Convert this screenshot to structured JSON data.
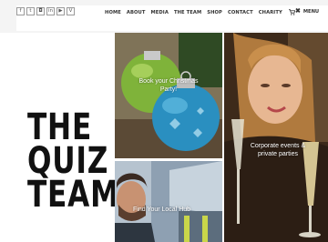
{
  "socials": [
    {
      "icon": "facebook-icon",
      "glyph": "f"
    },
    {
      "icon": "twitter-icon",
      "glyph": "t"
    },
    {
      "icon": "instagram-icon",
      "glyph": "◘"
    },
    {
      "icon": "linkedin-icon",
      "glyph": "in"
    },
    {
      "icon": "youtube-icon",
      "glyph": "▶"
    },
    {
      "icon": "vimeo-icon",
      "glyph": "V"
    }
  ],
  "nav": {
    "home": "HOME",
    "about": "ABOUT",
    "media": "MEDIA",
    "team": "THE TEAM",
    "shop": "SHOP",
    "contact": "CONTACT",
    "charity": "CHARITY",
    "cart_icon": "cart-icon"
  },
  "menu": {
    "label": "MENU",
    "icon": "close-menu-icon"
  },
  "hero": {
    "line1": "THE",
    "line2": "QUIZ",
    "line3": "TEAM"
  },
  "tiles": {
    "xmas": "Book your Christmas Party!",
    "corporate": "Corporate events & private parties",
    "find": "Find Your Local Hub"
  }
}
